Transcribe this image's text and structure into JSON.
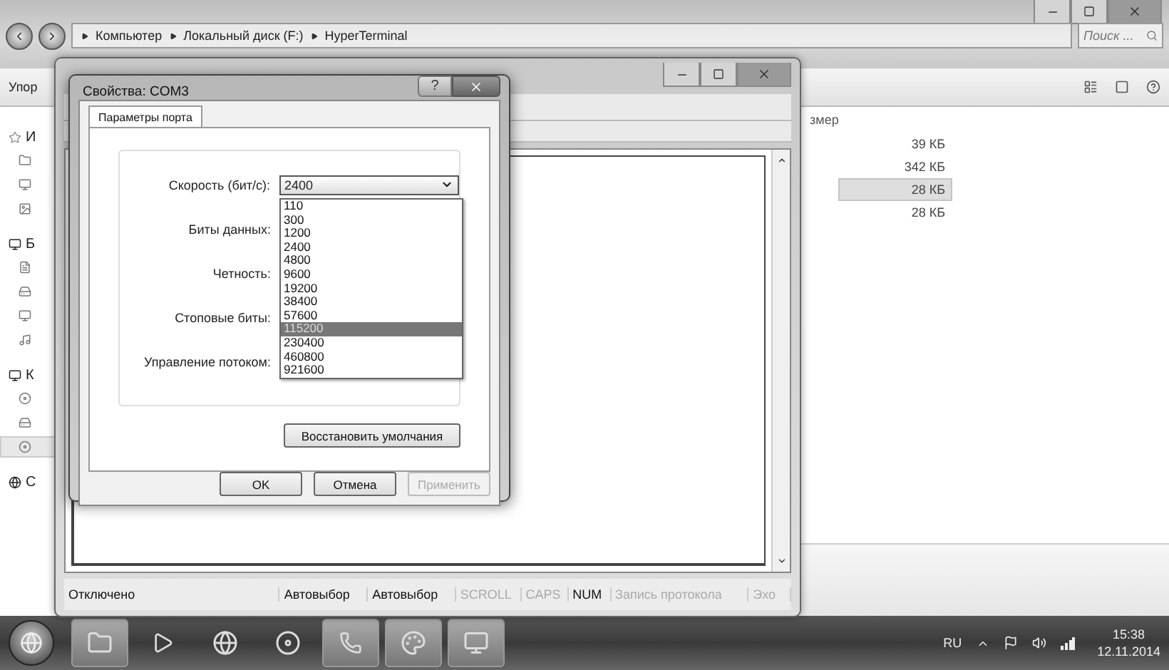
{
  "explorer": {
    "breadcrumbs": [
      "Компьютер",
      "Локальный диск (F:)",
      "HyperTerminal"
    ],
    "search": {
      "placeholder": "Поиск ..."
    },
    "toolbar_label": "Упор",
    "nav_groups": [
      {
        "label": "И",
        "items": [
          {
            "selected": false
          },
          {
            "selected": false
          },
          {
            "selected": false
          }
        ]
      },
      {
        "label": "Б",
        "items": [
          {
            "selected": false
          },
          {
            "selected": false
          },
          {
            "selected": false
          },
          {
            "selected": false
          }
        ]
      },
      {
        "label": "К",
        "items": [
          {
            "selected": false
          },
          {
            "selected": false
          },
          {
            "selected": true
          }
        ]
      },
      {
        "label": "С"
      }
    ],
    "column_header": "змер",
    "sizes": [
      {
        "text": "39 КБ",
        "selected": false
      },
      {
        "text": "342 КБ",
        "selected": false
      },
      {
        "text": "28 КБ",
        "selected": true
      },
      {
        "text": "28 КБ",
        "selected": false
      }
    ]
  },
  "terminal": {
    "status_bar": [
      {
        "text": "Отключено",
        "disabled": false
      },
      {
        "text": "Автовыбор",
        "disabled": false
      },
      {
        "text": "Автовыбор",
        "disabled": false
      },
      {
        "text": "SCROLL",
        "disabled": true
      },
      {
        "text": "CAPS",
        "disabled": true
      },
      {
        "text": "NUM",
        "disabled": false
      },
      {
        "text": "Запись протокола",
        "disabled": true
      },
      {
        "text": "Эхо",
        "disabled": true
      }
    ]
  },
  "dialog": {
    "title": "Свойства: COM3",
    "help_glyph": "?",
    "tabs": [
      {
        "label": "Параметры порта",
        "selected": true
      }
    ],
    "fields": [
      {
        "label": "Скорость (бит/с):",
        "value": "2400"
      },
      {
        "label": "Биты данных:"
      },
      {
        "label": "Четность:"
      },
      {
        "label": "Стоповые биты:"
      },
      {
        "label": "Управление потоком:"
      }
    ],
    "dropdown_options": [
      {
        "label": "110",
        "selected": false
      },
      {
        "label": "300",
        "selected": false
      },
      {
        "label": "1200",
        "selected": false
      },
      {
        "label": "2400",
        "selected": false
      },
      {
        "label": "4800",
        "selected": false
      },
      {
        "label": "9600",
        "selected": false
      },
      {
        "label": "19200",
        "selected": false
      },
      {
        "label": "38400",
        "selected": false
      },
      {
        "label": "57600",
        "selected": false
      },
      {
        "label": "115200",
        "selected": true
      },
      {
        "label": "230400",
        "selected": false
      },
      {
        "label": "460800",
        "selected": false
      },
      {
        "label": "921600",
        "selected": false
      }
    ],
    "restore_button": "Восстановить умолчания",
    "buttons": [
      {
        "label": "OK",
        "disabled": false
      },
      {
        "label": "Отмена",
        "disabled": false
      },
      {
        "label": "Применить",
        "disabled": true
      }
    ]
  },
  "taskbar": {
    "language": "RU",
    "time": "15:38",
    "date": "12.11.2014"
  }
}
